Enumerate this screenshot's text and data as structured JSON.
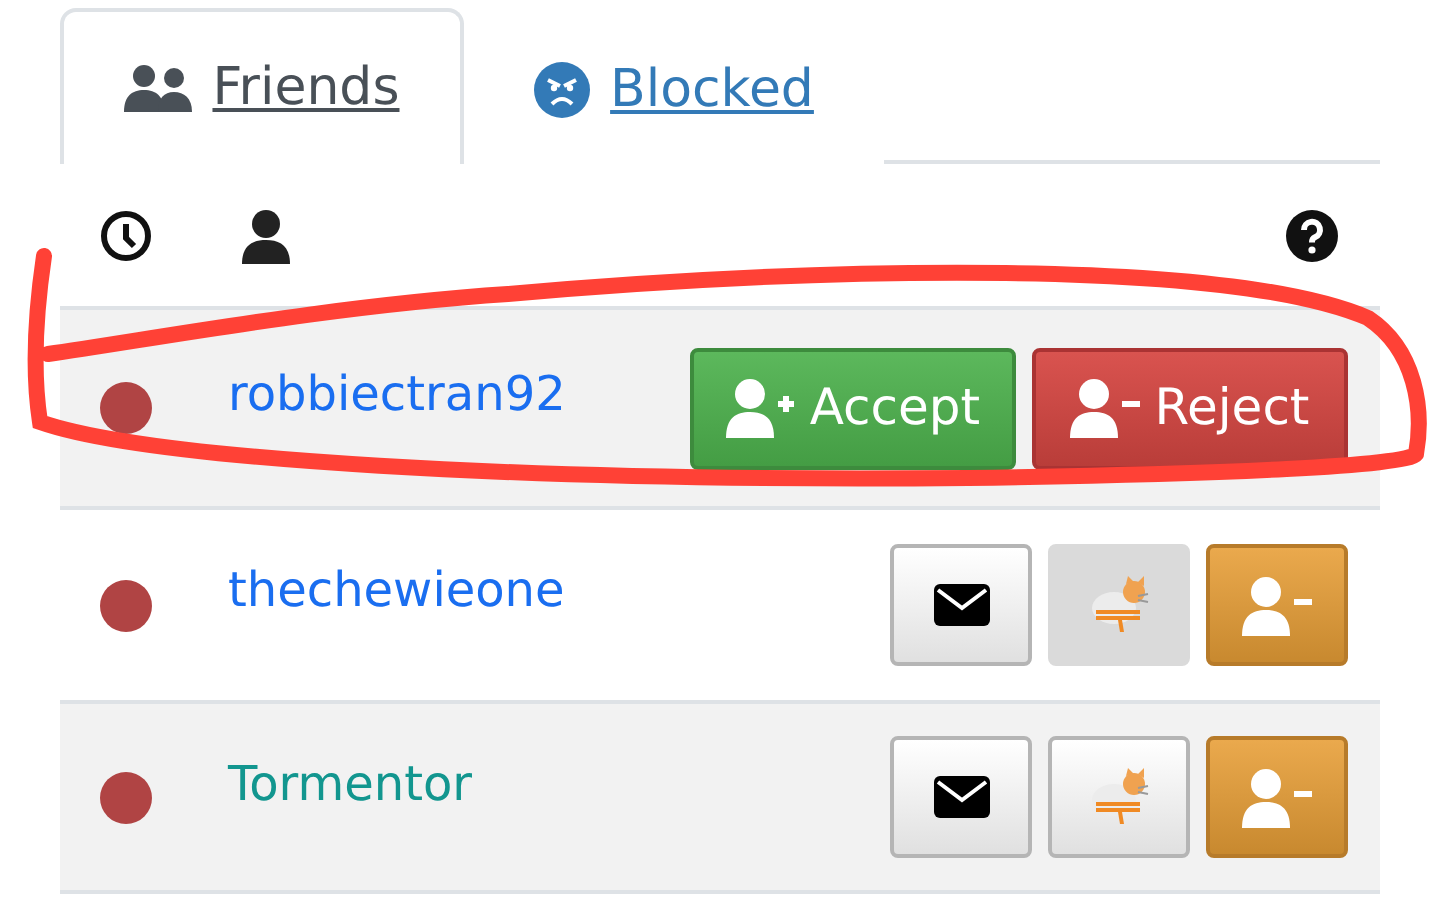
{
  "tabs": [
    {
      "label": "Friends",
      "kind": "friends",
      "selected": true
    },
    {
      "label": "Blocked",
      "kind": "blocked",
      "selected": false
    }
  ],
  "rows": [
    {
      "kind": "request",
      "name": "robbiectran92",
      "color": "#1a6ef0",
      "circled": true,
      "accept": "Accept",
      "reject": "Reject"
    },
    {
      "kind": "friend",
      "name": "thechewieone",
      "color": "#1a6ef0",
      "circled": false,
      "cat_disabled": true
    },
    {
      "kind": "friend",
      "name": "Tormentor",
      "color": "#12968f",
      "circled": false,
      "cat_disabled": false
    }
  ]
}
